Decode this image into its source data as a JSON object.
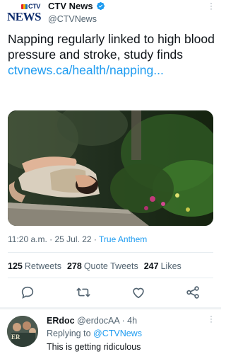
{
  "tweet": {
    "logo": {
      "brand": "CTV",
      "word": "NEWS"
    },
    "display_name": "CTV News",
    "handle": "@CTVNews",
    "text_main": "Napping regularly linked to high blood pressure and stroke, study finds ",
    "text_link": "ctvnews.ca/health/napping...",
    "time": "11:20 a.m.",
    "date": "25 Jul. 22",
    "source": "True Anthem",
    "separator": "·",
    "stats": {
      "retweets_count": "125",
      "retweets_label": "Retweets",
      "quotes_count": "278",
      "quotes_label": "Quote Tweets",
      "likes_count": "247",
      "likes_label": "Likes"
    },
    "icons": [
      "reply-icon",
      "retweet-icon",
      "like-icon",
      "share-icon"
    ]
  },
  "reply": {
    "display_name": "ERdoc",
    "handle": "@erdocAA",
    "age": "4h",
    "replying_prefix": "Replying to ",
    "replying_to": "@CTVNews",
    "text": "This is getting ridiculous"
  },
  "colors": {
    "accent": "#1d9bf0",
    "secondary_text": "#536471",
    "primary_text": "#0f1419"
  }
}
